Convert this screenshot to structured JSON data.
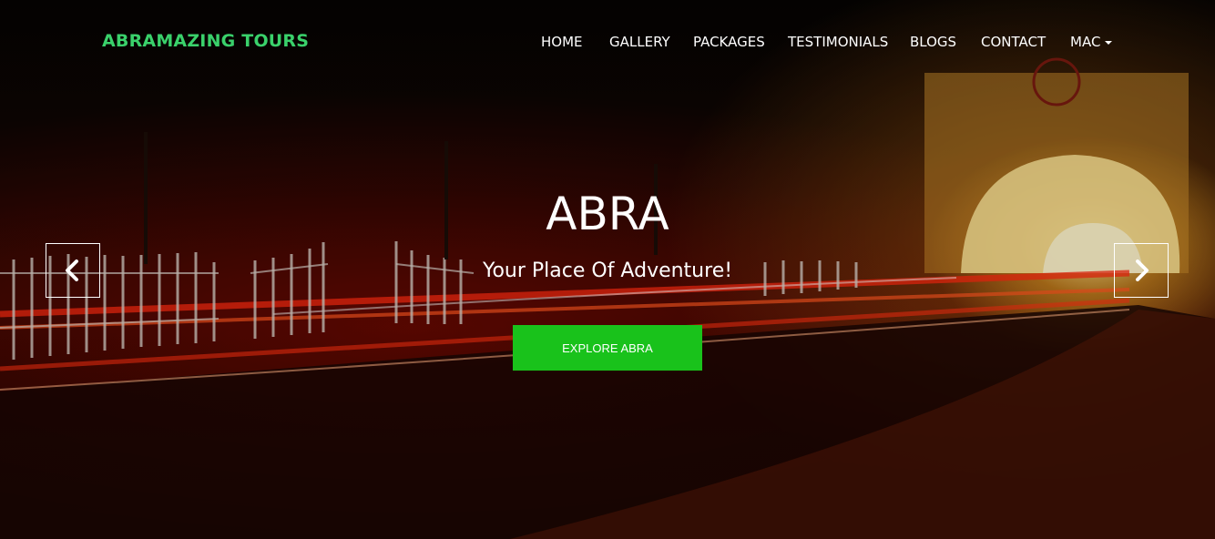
{
  "header": {
    "brand": "ABRAMAZING TOURS",
    "brand_color": "#3ad16b",
    "nav": [
      {
        "label": "HOME"
      },
      {
        "label": "GALLERY"
      },
      {
        "label": "PACKAGES"
      },
      {
        "label": "TESTIMONIALS"
      },
      {
        "label": "BLOGS"
      },
      {
        "label": "CONTACT"
      },
      {
        "label": "MAC",
        "has_dropdown": true
      }
    ]
  },
  "hero": {
    "title": "ABRA",
    "subtitle": "Your Place Of Adventure!",
    "cta_label": "EXPLORE ABRA",
    "cta_color": "#19c21b",
    "prev_icon": "chevron-left-icon",
    "next_icon": "chevron-right-icon",
    "background": "night road with red light trails, white picket fence and illuminated tunnel gate"
  }
}
